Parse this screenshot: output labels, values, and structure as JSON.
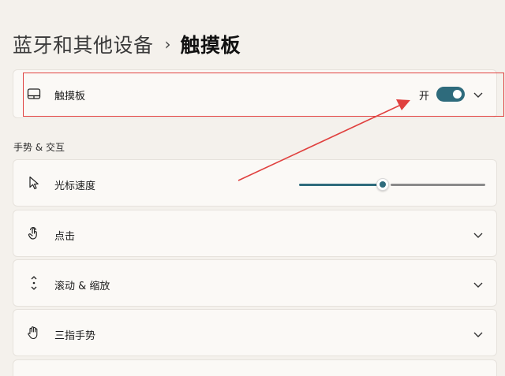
{
  "breadcrumb": {
    "parent": "蓝牙和其他设备",
    "separator": "›",
    "current": "触摸板"
  },
  "touchpad_card": {
    "label": "触摸板",
    "toggle_text": "开",
    "toggle_on": true
  },
  "section": {
    "title": "手势 & 交互"
  },
  "cursor_speed": {
    "label": "光标速度",
    "level_fraction": 0.45
  },
  "rows": [
    {
      "label": "点击",
      "icon": "tap-icon"
    },
    {
      "label": "滚动 & 缩放",
      "icon": "scroll-icon"
    },
    {
      "label": "三指手势",
      "icon": "three-finger-icon"
    }
  ],
  "colors": {
    "accent": "#2e6b7c",
    "annotation_red": "#e0413f"
  }
}
